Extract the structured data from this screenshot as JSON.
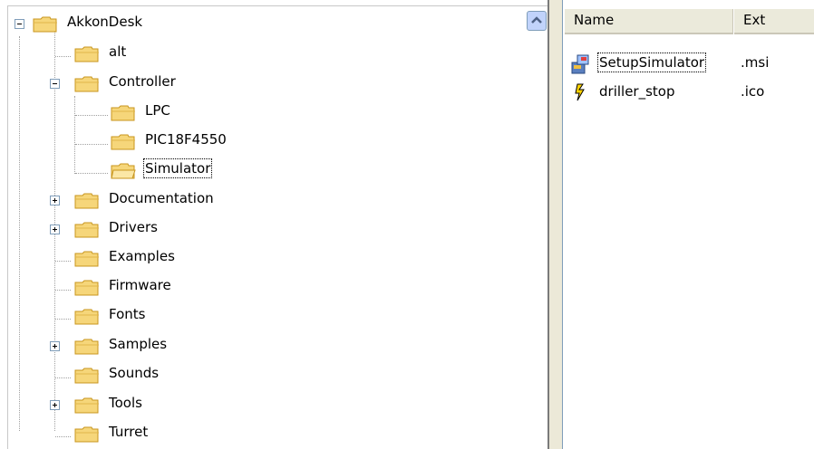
{
  "tree": {
    "items": [
      {
        "label": "AkkonDesk",
        "expander": "minus"
      },
      {
        "label": "alt",
        "expander": ""
      },
      {
        "label": "Controller",
        "expander": "minus"
      },
      {
        "label": "LPC",
        "expander": ""
      },
      {
        "label": "PIC18F4550",
        "expander": ""
      },
      {
        "label": "Simulator",
        "expander": "",
        "selected": true
      },
      {
        "label": "Documentation",
        "expander": "plus"
      },
      {
        "label": "Drivers",
        "expander": "plus"
      },
      {
        "label": "Examples",
        "expander": ""
      },
      {
        "label": "Firmware",
        "expander": ""
      },
      {
        "label": "Fonts",
        "expander": ""
      },
      {
        "label": "Samples",
        "expander": "plus"
      },
      {
        "label": "Sounds",
        "expander": ""
      },
      {
        "label": "Tools",
        "expander": "plus"
      },
      {
        "label": "Turret",
        "expander": ""
      }
    ]
  },
  "list": {
    "columns": {
      "name": "Name",
      "ext": "Ext"
    },
    "rows": [
      {
        "name": "SetupSimulator",
        "ext": ".msi",
        "icon": "installer-icon"
      },
      {
        "name": "driller_stop",
        "ext": ".ico",
        "icon": "ico-file-icon"
      }
    ]
  },
  "colors": {
    "folder": "#f6d67a",
    "folder_edge": "#c8961e",
    "selection_focus": "#000000"
  }
}
